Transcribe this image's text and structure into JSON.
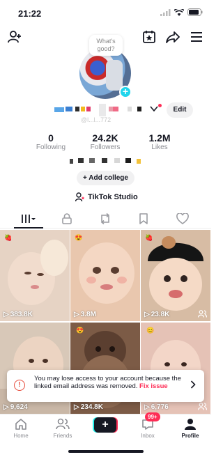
{
  "status_bar": {
    "time": "21:22"
  },
  "profile": {
    "bubble_text": "What's good?",
    "handle": "@l...l...772",
    "edit_label": "Edit"
  },
  "stats": [
    {
      "value": "0",
      "label": "Following"
    },
    {
      "value": "24.2K",
      "label": "Followers"
    },
    {
      "value": "1.2M",
      "label": "Likes"
    }
  ],
  "add_college_label": "+ Add college",
  "studio_label": "TikTok Studio",
  "videos": [
    {
      "views": "383.8K",
      "bg": "#e6d3c4"
    },
    {
      "views": "3.8M",
      "bg": "#e9c7ae"
    },
    {
      "views": "23.8K",
      "bg": "#d7bca4"
    },
    {
      "views": "9,624",
      "bg": "#d8c8b8"
    },
    {
      "views": "234.8K",
      "bg": "#7c5b46"
    },
    {
      "views": "6,776",
      "bg": "#e5c2b6"
    }
  ],
  "toast": {
    "message": "You may lose access to your account because the linked email address was removed.",
    "link": "Fix issue"
  },
  "nav": {
    "home": "Home",
    "friends": "Friends",
    "inbox": "Inbox",
    "profile": "Profile",
    "badge": "99+"
  },
  "colors": {
    "accent": "#fe2c55",
    "cyan": "#20d5ec",
    "text": "#161823"
  }
}
